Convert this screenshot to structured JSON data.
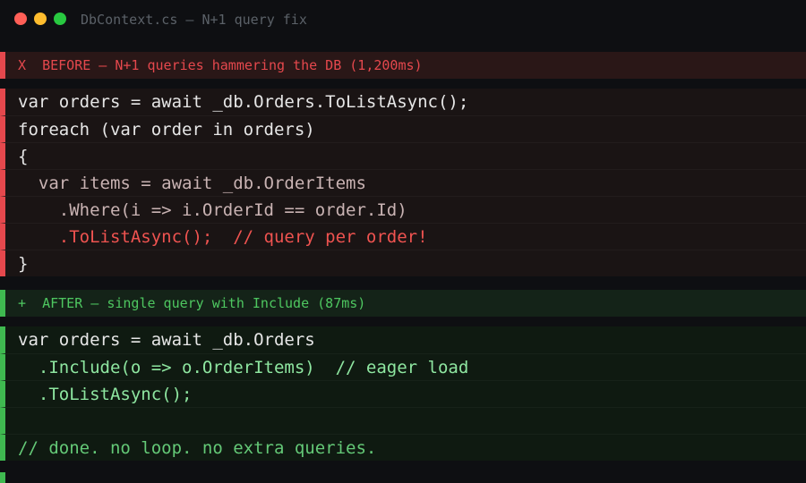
{
  "window": {
    "title": "DbContext.cs — N+1 query fix",
    "controls": [
      "close",
      "minimize",
      "zoom"
    ]
  },
  "before": {
    "banner": "X  BEFORE — N+1 queries hammering the DB (1,200ms)",
    "lines": [
      "var orders = await _db.Orders.ToListAsync();",
      "foreach (var order in orders)",
      "{",
      "  var items = await _db.OrderItems",
      "    .Where(i => i.OrderId == order.Id)",
      "    .ToListAsync();  // query per order!",
      "}"
    ]
  },
  "after": {
    "banner": "+  AFTER — single query with Include (87ms)",
    "lines": [
      "var orders = await _db.Orders",
      "  .Include(o => o.OrderItems)  // eager load",
      "  .ToListAsync();",
      "",
      "// done. no loop. no extra queries."
    ]
  },
  "colors": {
    "removed": "#e5484d",
    "added": "#3fb950"
  }
}
